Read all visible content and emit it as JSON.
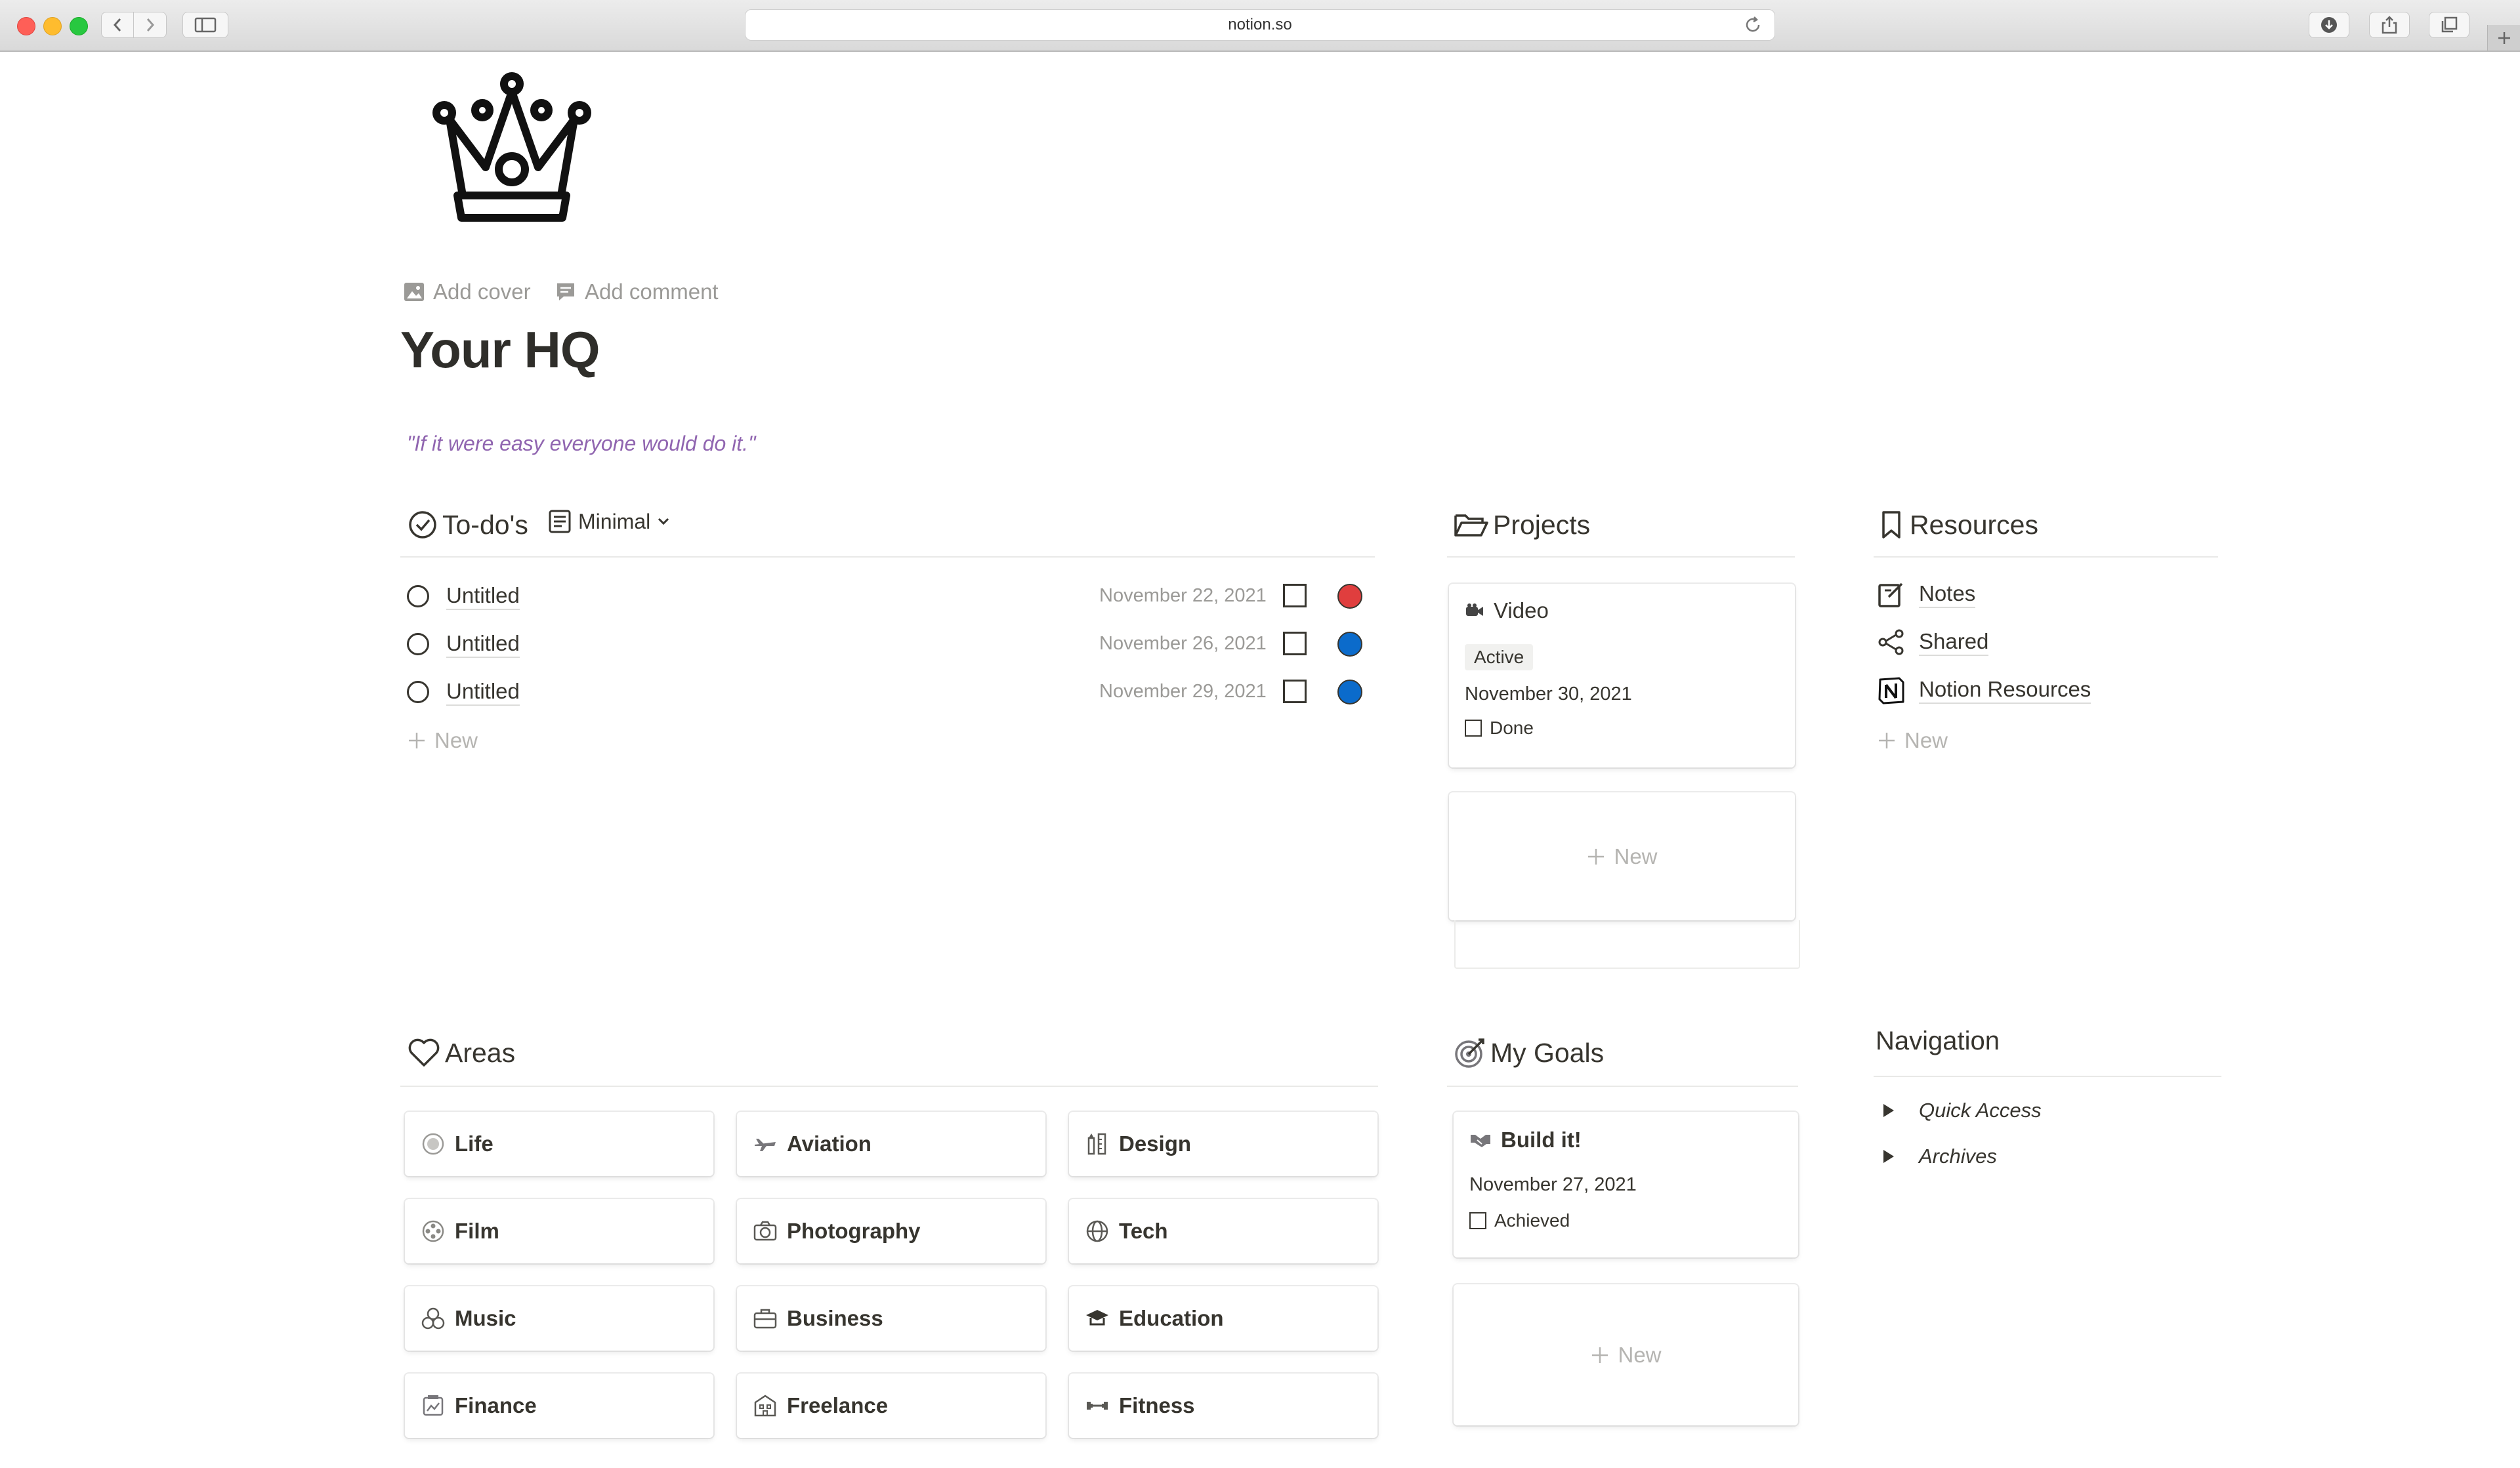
{
  "browser": {
    "url": "notion.so"
  },
  "page": {
    "icon": "crown-icon",
    "add_cover": "Add cover",
    "add_comment": "Add comment",
    "title": "Your HQ",
    "quote": "\"If it were easy everyone would do it.\""
  },
  "todos": {
    "heading": "To-do's",
    "view": "Minimal",
    "items": [
      {
        "title": "Untitled",
        "date": "November 22, 2021",
        "priority_color": "#e03e3e"
      },
      {
        "title": "Untitled",
        "date": "November 26, 2021",
        "priority_color": "#0b6bcb"
      },
      {
        "title": "Untitled",
        "date": "November 29, 2021",
        "priority_color": "#0b6bcb"
      }
    ],
    "new_label": "New"
  },
  "projects": {
    "heading": "Projects",
    "card": {
      "title": "Video",
      "status": "Active",
      "date": "November 30, 2021",
      "done_label": "Done"
    },
    "new_label": "New"
  },
  "resources": {
    "heading": "Resources",
    "items": [
      {
        "label": "Notes",
        "icon": "note-edit-icon"
      },
      {
        "label": "Shared",
        "icon": "share-icon"
      },
      {
        "label": "Notion Resources",
        "icon": "notion-logo-icon"
      }
    ],
    "new_label": "New"
  },
  "areas": {
    "heading": "Areas",
    "items": [
      {
        "label": "Life",
        "icon": "circle-icon"
      },
      {
        "label": "Aviation",
        "icon": "airplane-icon"
      },
      {
        "label": "Design",
        "icon": "design-tools-icon"
      },
      {
        "label": "Film",
        "icon": "film-reel-icon"
      },
      {
        "label": "Photography",
        "icon": "camera-icon"
      },
      {
        "label": "Tech",
        "icon": "globe-icon"
      },
      {
        "label": "Music",
        "icon": "music-icon"
      },
      {
        "label": "Business",
        "icon": "briefcase-icon"
      },
      {
        "label": "Education",
        "icon": "graduation-cap-icon"
      },
      {
        "label": "Finance",
        "icon": "finance-icon"
      },
      {
        "label": "Freelance",
        "icon": "building-icon"
      },
      {
        "label": "Fitness",
        "icon": "dumbbell-icon"
      }
    ]
  },
  "goals": {
    "heading": "My Goals",
    "card": {
      "title": "Build it!",
      "date": "November 27, 2021",
      "achieved_label": "Achieved"
    },
    "new_label": "New"
  },
  "navigation": {
    "heading": "Navigation",
    "items": [
      "Quick Access",
      "Archives"
    ]
  }
}
